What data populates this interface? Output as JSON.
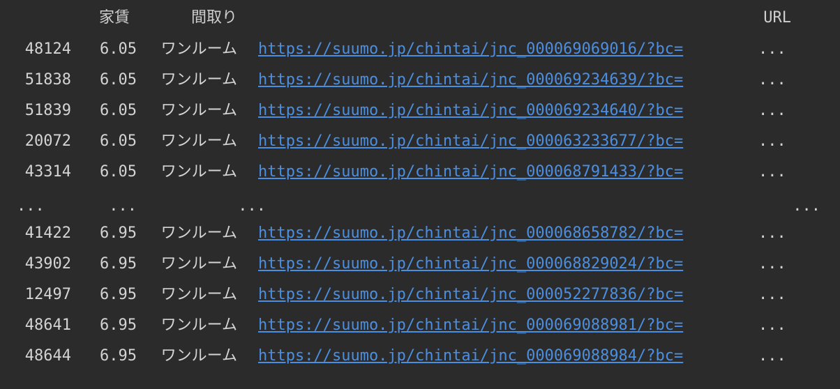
{
  "header": {
    "rent": "家賃",
    "layout": "間取り",
    "url": "URL"
  },
  "link_color": "#4c8fe0",
  "rows_top": [
    {
      "index": "48124",
      "rent": "6.05",
      "layout": "ワンルーム",
      "url": "https://suumo.jp/chintai/jnc_000069069016/?bc=",
      "ellipsis": "..."
    },
    {
      "index": "51838",
      "rent": "6.05",
      "layout": "ワンルーム",
      "url": "https://suumo.jp/chintai/jnc_000069234639/?bc=",
      "ellipsis": "..."
    },
    {
      "index": "51839",
      "rent": "6.05",
      "layout": "ワンルーム",
      "url": "https://suumo.jp/chintai/jnc_000069234640/?bc=",
      "ellipsis": "..."
    },
    {
      "index": "20072",
      "rent": "6.05",
      "layout": "ワンルーム",
      "url": "https://suumo.jp/chintai/jnc_000063233677/?bc=",
      "ellipsis": "..."
    },
    {
      "index": "43314",
      "rent": "6.05",
      "layout": "ワンルーム",
      "url": "https://suumo.jp/chintai/jnc_000068791433/?bc=",
      "ellipsis": "..."
    }
  ],
  "ellipsis_row": {
    "index": "...",
    "rent": "...",
    "layout": "...",
    "url": "..."
  },
  "rows_bottom": [
    {
      "index": "41422",
      "rent": "6.95",
      "layout": "ワンルーム",
      "url": "https://suumo.jp/chintai/jnc_000068658782/?bc=",
      "ellipsis": "..."
    },
    {
      "index": "43902",
      "rent": "6.95",
      "layout": "ワンルーム",
      "url": "https://suumo.jp/chintai/jnc_000068829024/?bc=",
      "ellipsis": "..."
    },
    {
      "index": "12497",
      "rent": "6.95",
      "layout": "ワンルーム",
      "url": "https://suumo.jp/chintai/jnc_000052277836/?bc=",
      "ellipsis": "..."
    },
    {
      "index": "48641",
      "rent": "6.95",
      "layout": "ワンルーム",
      "url": "https://suumo.jp/chintai/jnc_000069088981/?bc=",
      "ellipsis": "..."
    },
    {
      "index": "48644",
      "rent": "6.95",
      "layout": "ワンルーム",
      "url": "https://suumo.jp/chintai/jnc_000069088984/?bc=",
      "ellipsis": "..."
    }
  ]
}
